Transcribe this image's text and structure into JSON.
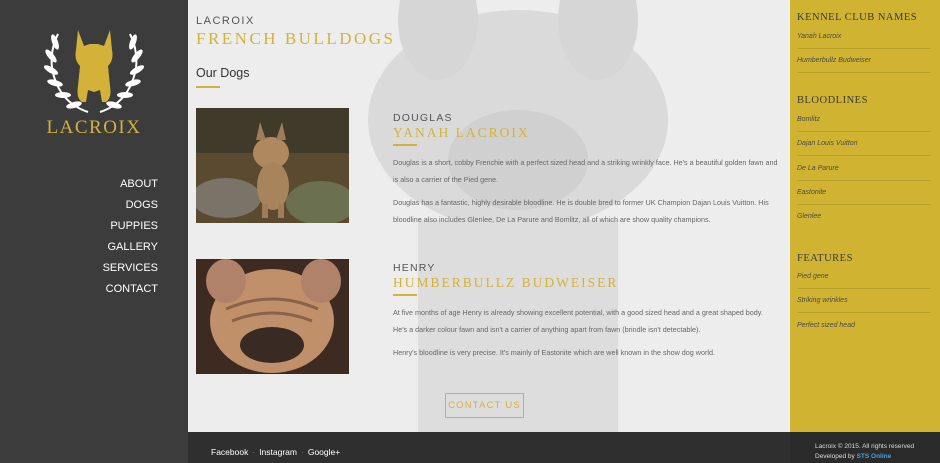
{
  "brand": {
    "name": "LACROIX"
  },
  "nav": {
    "items": [
      "ABOUT",
      "DOGS",
      "PUPPIES",
      "GALLERY",
      "SERVICES",
      "CONTACT"
    ]
  },
  "header": {
    "subtitle": "LACROIX",
    "title": "FRENCH BULLDOGS"
  },
  "section": {
    "title": "Our Dogs"
  },
  "dogs": [
    {
      "name": "DOUGLAS",
      "kennel_name": "YANAH LACROIX",
      "paragraphs": [
        "Douglas is a short, cobby Frenchie with a perfect sized head and a striking wrinkly face. He's a beautiful golden fawn and is also a carrier of the Pied gene.",
        "Douglas has a fantastic, highly desirable bloodline. He is double bred to former UK Champion Dajan Louis Vuitton. His bloodline also includes Glenlee, De La Parure and Bomlitz, all of which are show quality champions."
      ]
    },
    {
      "name": "HENRY",
      "kennel_name": "HUMBERBULLZ BUDWEISER",
      "paragraphs": [
        "At five months of age Henry is already showing excellent potential, with a good sized head and a great shaped body. He's a darker colour fawn and isn't a carrier of anything apart from fawn (brindle isn't detectable).",
        "Henry's bloodline is very precise. It's mainly of Eastonite which are well known in the show dog world."
      ]
    }
  ],
  "contact_button": "CONTACT US",
  "rightbar": {
    "kennel_heading": "KENNEL CLUB NAMES",
    "kennel_items": [
      "Yanah Lacroix",
      "Humberbullz Budweiser"
    ],
    "bloodlines_heading": "BLOODLINES",
    "bloodlines_items": [
      "Bomlitz",
      "Dajan Louis Vuitton",
      "De La Parure",
      "Eastonite",
      "Glenlee"
    ],
    "features_heading": "FEATURES",
    "features_items": [
      "Pied gene",
      "Striking wrinkles",
      "Perfect sized head"
    ]
  },
  "footer": {
    "social": [
      "Facebook",
      "Instagram",
      "Google+"
    ],
    "copyright": "Lacroix © 2015. All rights reserved",
    "developed_by": "Developed by",
    "developer": "STS Online"
  },
  "colors": {
    "gold": "#d4b23a",
    "sidebar": "#3c3c3c",
    "rightbar": "#d0b431",
    "footer": "#2f2f2f"
  },
  "icons": [
    "laurel-bulldog-logo-icon"
  ]
}
